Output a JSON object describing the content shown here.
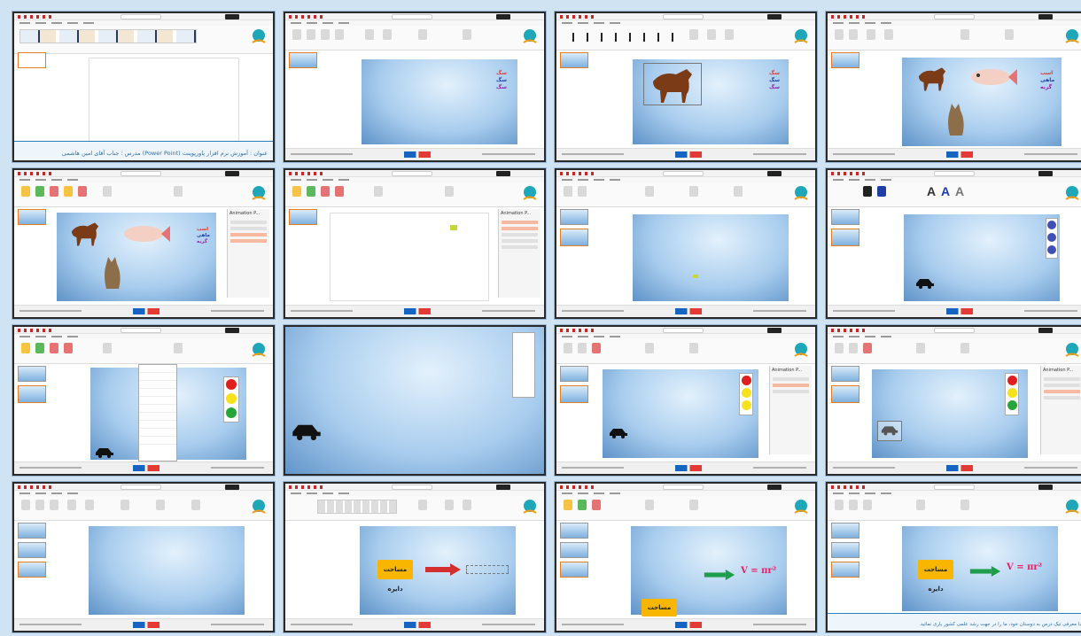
{
  "tiles": [
    {
      "id": 1,
      "caption": "عنوان : آموزش نرم افزار پاورپوینت (Power Point)     مدرس : جناب آقای امین هاشمی"
    },
    {
      "id": 2,
      "words": [
        "سگ",
        "سگ",
        "سگ"
      ]
    },
    {
      "id": 3,
      "words": [
        "سگ",
        "سگ",
        "سگ"
      ]
    },
    {
      "id": 4,
      "words": [
        "اسب",
        "ماهی",
        "گربه"
      ]
    },
    {
      "id": 5,
      "pane_title": "Animation P...",
      "words": [
        "اسب",
        "ماهی",
        "گربه"
      ]
    },
    {
      "id": 6,
      "pane_title": "Animation P..."
    },
    {
      "id": 7
    },
    {
      "id": 8
    },
    {
      "id": 9
    },
    {
      "id": 10
    },
    {
      "id": 11,
      "pane_title": "Animation P..."
    },
    {
      "id": 12,
      "pane_title": "Animation P..."
    },
    {
      "id": 13
    },
    {
      "id": 14,
      "box": "مساحت دایره"
    },
    {
      "id": 15,
      "box": "مساحت دایره",
      "formula": "V = πr²"
    },
    {
      "id": 16,
      "box": "مساحت دایره",
      "formula": "V = πr²",
      "caption": "با معرفی تیک درس به دوستان خود، ما را در جهت رشد علمی کشور یاری نمائید."
    }
  ],
  "icons": {
    "horse": "horse-icon",
    "fish": "fish-icon",
    "cat": "cat-icon",
    "car": "car-icon",
    "traffic_light": "traffic-light-icon",
    "arrow": "arrow-icon",
    "logo": "tickdars-logo-icon"
  },
  "colors": {
    "background": "#cfe3f3",
    "accent_red": "#d32f2f",
    "accent_green": "#1e9e4a",
    "box_yellow": "#f9b600",
    "formula_pink": "#e91e63",
    "word_red": "#e53935",
    "word_blue": "#1e3fa8",
    "word_purple": "#8e24aa"
  }
}
